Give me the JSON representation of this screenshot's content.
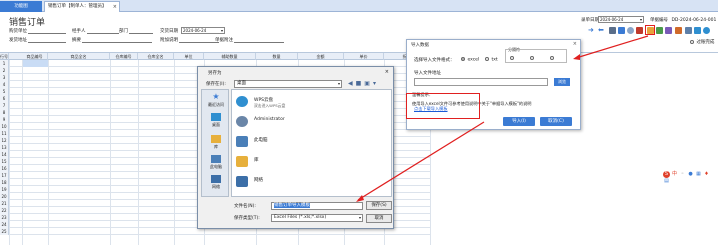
{
  "tabs": {
    "home": "功能图",
    "active": "销售订单【制单人：管理员】",
    "close": "×"
  },
  "page_title": "销售订单",
  "header_fields": {
    "customer": "购货单位",
    "handler": "经手人",
    "department": "部门",
    "delivery_date_label": "交货日期",
    "delivery_date": "2024-06-24",
    "settle_account": "发货地址",
    "summary": "摘要",
    "extra": "附加说明",
    "freight": "单据附注",
    "order_date_label": "录单日期",
    "order_date": "2024-06-24",
    "order_no_label": "单据编号",
    "order_no": "DD-2024-06-24-001",
    "confirm_label": "过账完成"
  },
  "grid": {
    "columns": [
      "行号",
      "商品编号",
      "商品全名",
      "仓库编号",
      "仓库全名",
      "单位",
      "辅助数量",
      "数量",
      "金额",
      "单价",
      "折扣"
    ],
    "rows": [
      "1",
      "2",
      "3",
      "4",
      "5",
      "6",
      "7",
      "8",
      "9",
      "10",
      "11",
      "12",
      "13",
      "14",
      "15",
      "16",
      "17",
      "18",
      "19",
      "20",
      "21",
      "22",
      "23",
      "24",
      "25"
    ]
  },
  "save_dialog": {
    "title": "另存为",
    "close": "×",
    "save_in_label": "保存在(I):",
    "save_in_value": "桌面",
    "places": [
      "最近访问",
      "桌面",
      "库",
      "此电脑",
      "网络"
    ],
    "files": [
      {
        "name": "WPS云盘",
        "sub": "双击进入WPS云盘"
      },
      {
        "name": "Administrator",
        "sub": ""
      },
      {
        "name": "此电脑",
        "sub": ""
      },
      {
        "name": "库",
        "sub": ""
      },
      {
        "name": "网络",
        "sub": ""
      }
    ],
    "filename_label": "文件名(N):",
    "filename_value": "销售订单导入模板",
    "filetype_label": "保存类型(T):",
    "filetype_value": "Excel Files (*.xls;*.xlsx)",
    "save_button": "保存(S)",
    "cancel_button": "取消"
  },
  "import_dialog": {
    "title": "导入数据",
    "close": "×",
    "file_format_label": "选择导入文件格式：",
    "option_excel": "excel",
    "option_txt": "txt",
    "separator_label": "分隔符",
    "file_path_label": "导入文件地址",
    "browse_button": "浏览",
    "tip_label": "温馨提示：",
    "tip_text": "使用导入excel文件可参考使用说明中关于\"单据导入模板\"的说明",
    "tip_link": "点击下载导入模板",
    "import_button": "导入(I)",
    "cancel_button": "取消(C)"
  },
  "colors": {
    "accent": "#3b7bd4",
    "highlight": "#e02020"
  }
}
